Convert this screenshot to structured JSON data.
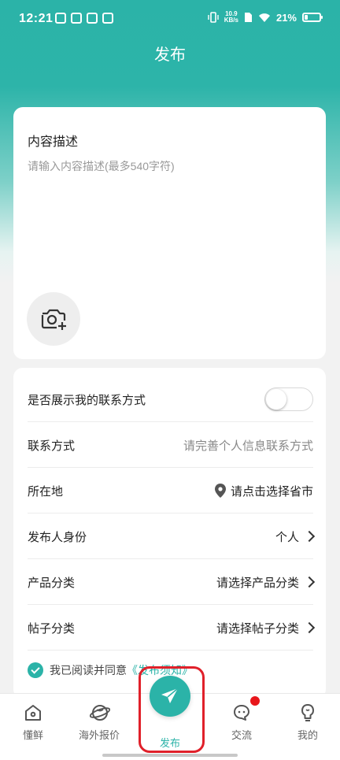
{
  "status_bar": {
    "time": "12:21",
    "net_speed_value": "10.9",
    "net_speed_unit": "KB/s",
    "battery_percent": "21%",
    "battery_level": 0.21
  },
  "header": {
    "title": "发布"
  },
  "description": {
    "title": "内容描述",
    "placeholder": "请输入内容描述(最多540字符)",
    "value": "",
    "camera_icon": "camera-add-icon"
  },
  "form": {
    "rows": [
      {
        "label": "是否展示我的联系方式",
        "type": "toggle",
        "on": false
      },
      {
        "label": "联系方式",
        "value": "请完善个人信息联系方式"
      },
      {
        "label": "所在地",
        "value": "请点击选择省市",
        "icon": "location-pin-icon"
      },
      {
        "label": "发布人身份",
        "value": "个人"
      },
      {
        "label": "产品分类",
        "value": "请选择产品分类"
      },
      {
        "label": "帖子分类",
        "value": "请选择帖子分类"
      }
    ],
    "agreement": {
      "prefix": "我已阅读并同意",
      "link": "《发布须知》",
      "checked": true
    }
  },
  "bottom_nav": {
    "items": [
      {
        "label": "懂鲜",
        "icon": "home-icon"
      },
      {
        "label": "海外报价",
        "icon": "globe-icon"
      },
      {
        "label": "发布",
        "icon": "paper-plane-icon",
        "active": true
      },
      {
        "label": "交流",
        "icon": "chat-icon",
        "badge": true
      },
      {
        "label": "我的",
        "icon": "profile-icon"
      }
    ]
  },
  "colors": {
    "accent": "#2bb3a8",
    "badge": "#e8161b",
    "highlight_frame": "#e0202a"
  }
}
